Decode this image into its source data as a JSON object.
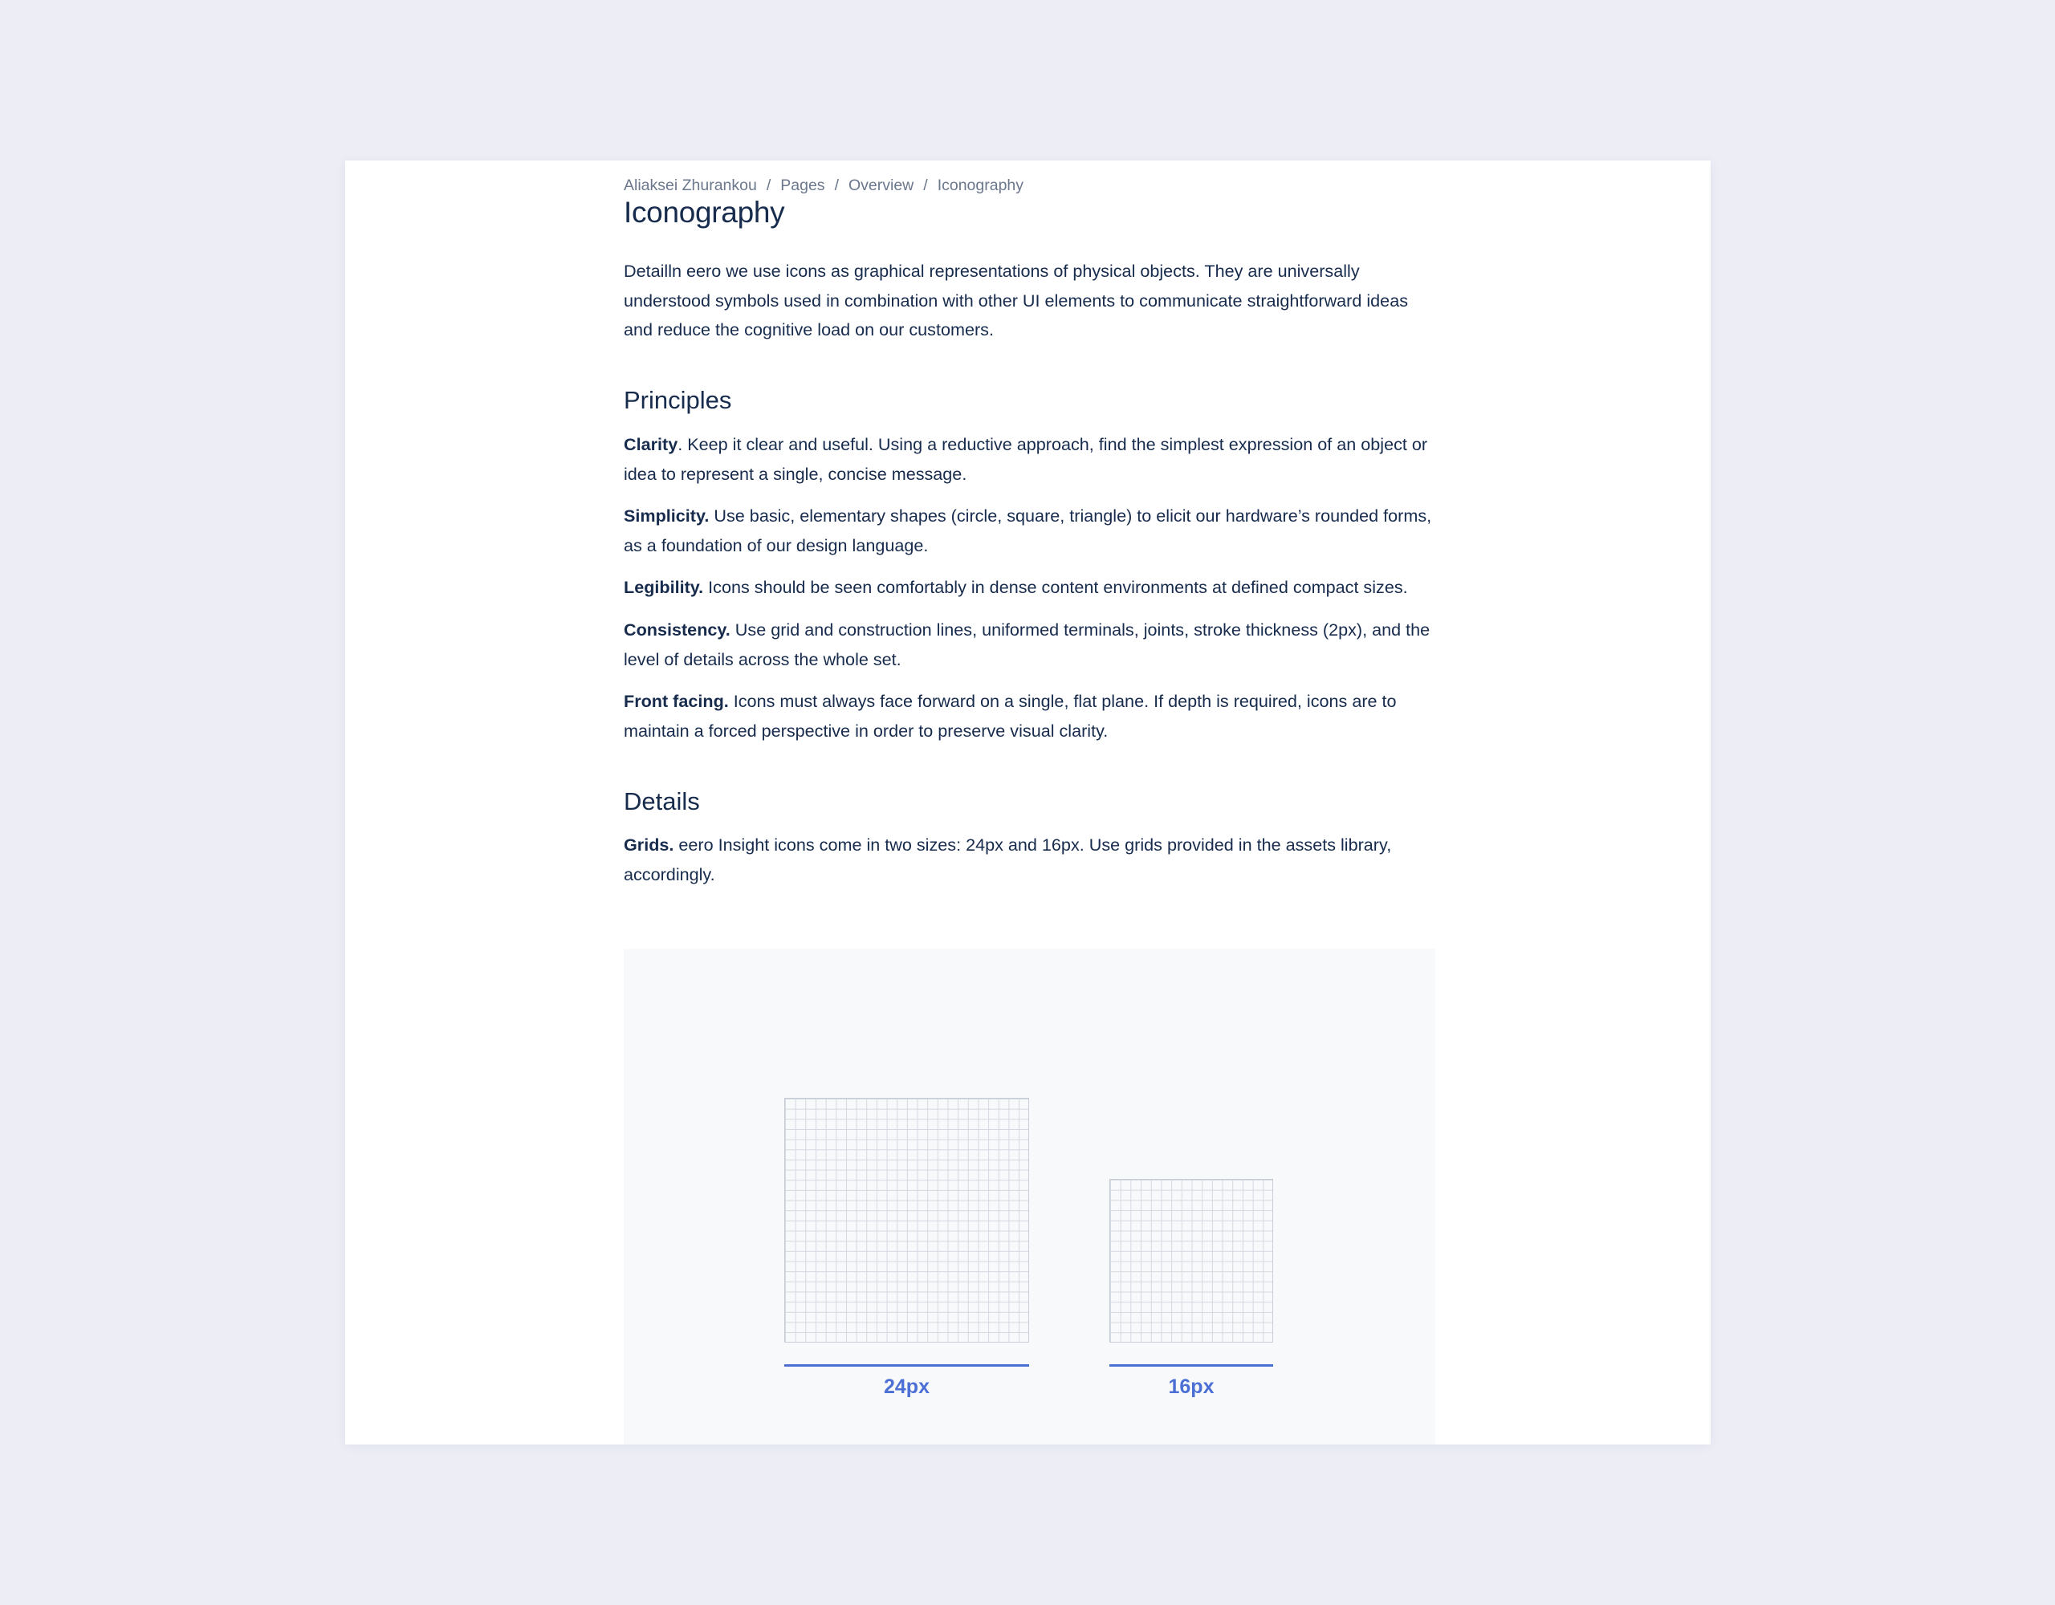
{
  "breadcrumb": {
    "items": [
      "Aliaksei Zhurankou",
      "Pages",
      "Overview",
      "Iconography"
    ],
    "separator": "/"
  },
  "page": {
    "title": "Iconography",
    "intro": "Detailln eero we use icons as graphical representations of physical objects. They are universally understood symbols used in combination with other UI elements to communicate straightforward ideas and reduce the cognitive load on our customers."
  },
  "principles": {
    "heading": "Principles",
    "items": [
      {
        "term": "Clarity",
        "text": ". Keep it clear and useful. Using a reductive approach, find the simplest expression of an object or idea to represent a single, concise message."
      },
      {
        "term": "Simplicity.",
        "text": " Use basic, elementary shapes (circle, square, triangle) to elicit our hardware’s rounded forms, as a foundation of our design language."
      },
      {
        "term": "Legibility.",
        "text": " Icons should be seen comfortably in dense content environments at defined compact sizes."
      },
      {
        "term": "Consistency.",
        "text": " Use grid and construction lines, uniformed terminals, joints, stroke thickness (2px), and the level of details across the whole set."
      },
      {
        "term": "Front facing.",
        "text": " Icons must always face forward on a single, flat plane. If depth is required, icons are to maintain a forced perspective in order to preserve visual clarity."
      }
    ]
  },
  "details": {
    "heading": "Details",
    "items": [
      {
        "term": "Grids.",
        "text": " eero Insight icons come in two sizes: 24px and 16px. Use grids provided in the assets library, accordingly."
      }
    ]
  },
  "figure": {
    "grids": [
      {
        "label": "24px",
        "cells": 24
      },
      {
        "label": "16px",
        "cells": 16
      }
    ]
  },
  "colors": {
    "background": "#ecedf5",
    "page": "#ffffff",
    "text": "#172b4d",
    "muted": "#6b778c",
    "accent": "#4c6fd6",
    "figure_bg": "#f8f9fb",
    "grid_line": "#d3d8e0"
  }
}
